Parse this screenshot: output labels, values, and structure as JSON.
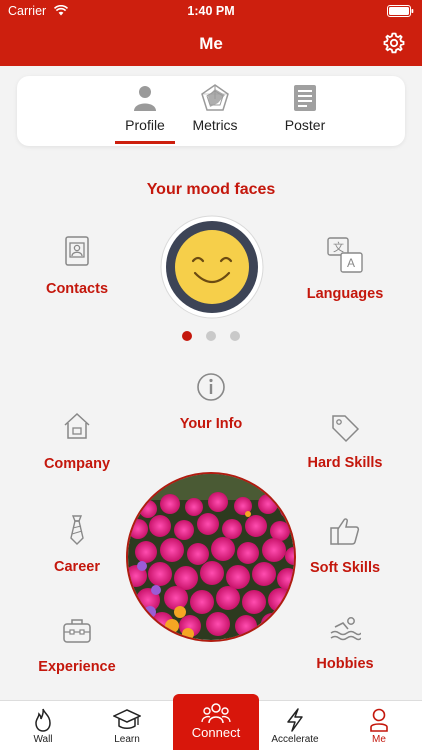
{
  "status_bar": {
    "carrier": "Carrier",
    "time": "1:40 PM"
  },
  "header": {
    "title": "Me"
  },
  "tabs": [
    {
      "label": "Profile",
      "icon": "person-icon",
      "selected": true
    },
    {
      "label": "Metrics",
      "icon": "radar-chart-icon",
      "selected": false
    },
    {
      "label": "Poster",
      "icon": "document-icon",
      "selected": false
    }
  ],
  "mood": {
    "title": "Your mood faces",
    "page_index": 1,
    "page_count": 3
  },
  "sections": {
    "contacts": "Contacts",
    "languages": "Languages",
    "your_info": "Your Info",
    "company": "Company",
    "hard_skills": "Hard Skills",
    "career": "Career",
    "soft_skills": "Soft Skills",
    "experience": "Experience",
    "hobbies": "Hobbies"
  },
  "bottom_nav": {
    "wall": "Wall",
    "learn": "Learn",
    "connect": "Connect",
    "accelerate": "Accelerate",
    "me": "Me"
  },
  "colors": {
    "brand": "#cd1f0e",
    "accent_text": "#c4170c",
    "background": "#f3f3f3"
  }
}
